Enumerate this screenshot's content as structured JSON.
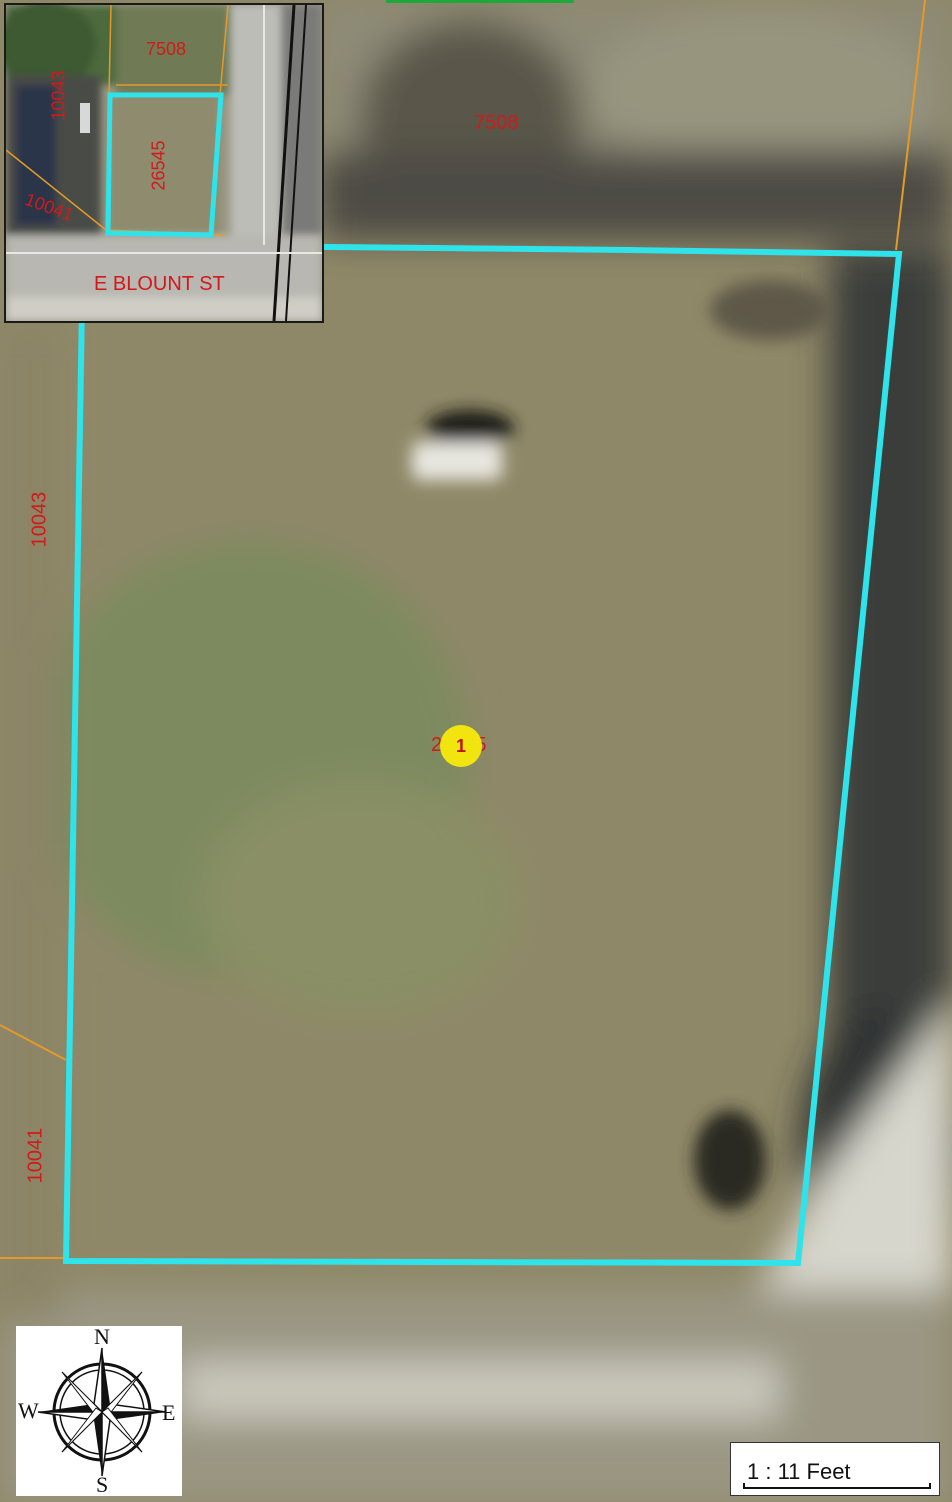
{
  "map": {
    "parcel_labels": {
      "north": "7508",
      "west_upper": "10043",
      "west_lower": "10041",
      "subject": "26545"
    },
    "marker_number": "1",
    "colors": {
      "parcel_outline": "#2fe3ea",
      "parcel_lines": "#e39a2a",
      "labels": "#d11a1a",
      "marker": "#f2e40e"
    }
  },
  "inset": {
    "parcel_labels": {
      "north": "7508",
      "west_upper": "10043",
      "west_lower": "10041",
      "subject": "26545"
    },
    "street_label": "E BLOUNT ST"
  },
  "compass": {
    "n": "N",
    "s": "S",
    "e": "E",
    "w": "W",
    "icon": "compass-rose-icon"
  },
  "scale": {
    "text": "1 : 11 Feet"
  }
}
